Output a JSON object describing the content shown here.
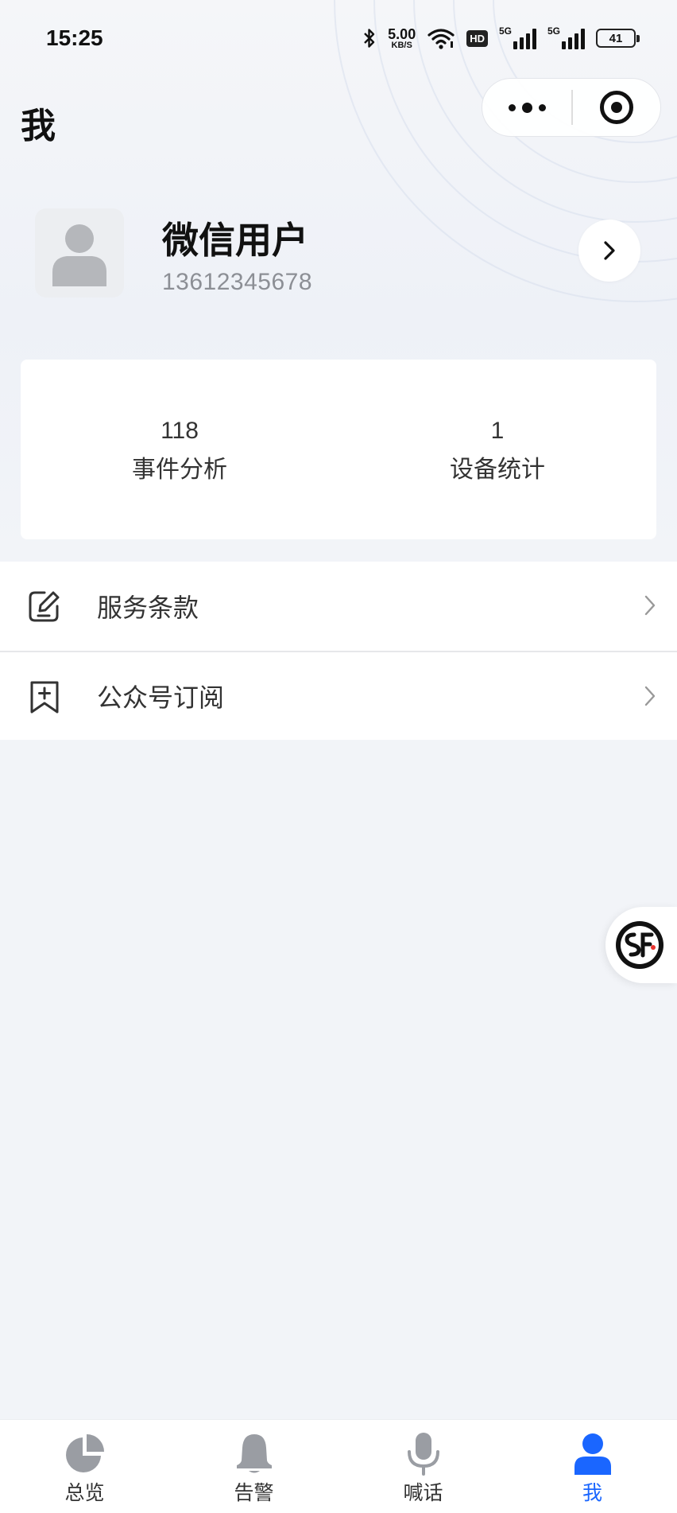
{
  "status_bar": {
    "time": "15:25",
    "net_speed": "5.00",
    "net_speed_unit": "KB/S",
    "hd_label": "HD",
    "signal1_label": "5G",
    "signal2_label": "5G",
    "battery": "41"
  },
  "nav": {
    "title": "我",
    "more_icon": "more-dots-icon",
    "close_icon": "target-icon"
  },
  "profile": {
    "name": "微信用户",
    "phone": "13612345678",
    "avatar_icon": "default-avatar-icon"
  },
  "stats": [
    {
      "value": "118",
      "label": "事件分析"
    },
    {
      "value": "1",
      "label": "设备统计"
    }
  ],
  "menu": [
    {
      "label": "服务条款",
      "icon": "edit-document-icon"
    },
    {
      "label": "公众号订阅",
      "icon": "bookmark-add-icon"
    }
  ],
  "floating": {
    "icon": "sf-logo-icon"
  },
  "tabbar": [
    {
      "label": "总览",
      "icon": "pie-chart-icon",
      "active": false
    },
    {
      "label": "告警",
      "icon": "bell-icon",
      "active": false
    },
    {
      "label": "喊话",
      "icon": "microphone-icon",
      "active": false
    },
    {
      "label": "我",
      "icon": "user-icon",
      "active": true
    }
  ],
  "colors": {
    "accent": "#1a66ff",
    "inactive_icon": "#9a9da3",
    "background": "#f2f4f8"
  }
}
